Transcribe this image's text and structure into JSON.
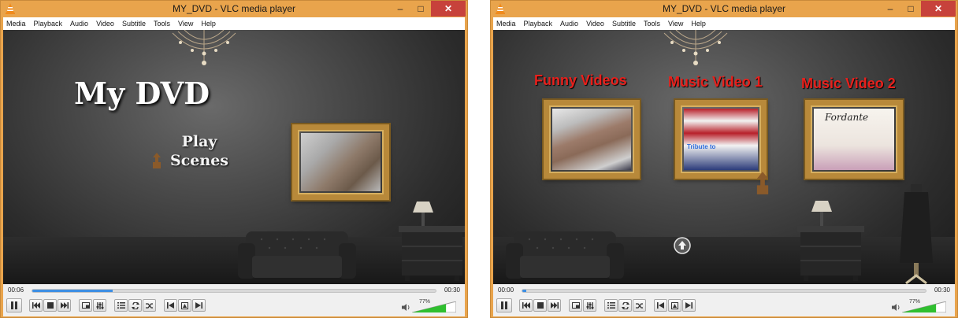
{
  "windows": [
    {
      "title": "MY_DVD - VLC media player",
      "menu": [
        "Media",
        "Playback",
        "Audio",
        "Video",
        "Subtitle",
        "Tools",
        "View",
        "Help"
      ],
      "window_buttons": {
        "minimize": "–",
        "maximize": "□",
        "close": "✕"
      },
      "screen": {
        "dvd_title": "My DVD",
        "play_label": "Play",
        "scenes_label": "Scenes"
      },
      "playback": {
        "elapsed": "00:06",
        "total": "00:30",
        "progress_fraction": 0.2,
        "volume_label": "77%",
        "volume_fraction": 0.77
      }
    },
    {
      "title": "MY_DVD - VLC media player",
      "menu": [
        "Media",
        "Playback",
        "Audio",
        "Video",
        "Subtitle",
        "Tools",
        "View",
        "Help"
      ],
      "window_buttons": {
        "minimize": "–",
        "maximize": "□",
        "close": "✕"
      },
      "screen": {
        "labels": [
          "Funny Videos",
          "Music Video 1",
          "Music Video 2"
        ],
        "thumb_text": "Tribute to",
        "thumb_text2": "Fordante"
      },
      "playback": {
        "elapsed": "00:00",
        "total": "00:30",
        "progress_fraction": 0.01,
        "volume_label": "77%",
        "volume_fraction": 0.77
      }
    }
  ],
  "colors": {
    "accent": "#3e8fe3",
    "titlebar": "#e9a44c",
    "label_red": "#e8201c",
    "volume_green": "#2fbf2f"
  }
}
